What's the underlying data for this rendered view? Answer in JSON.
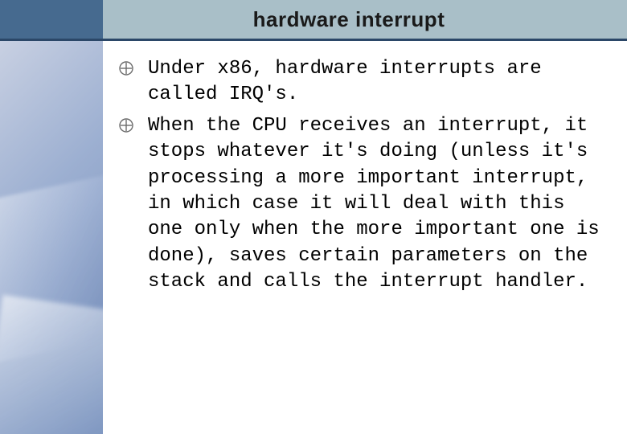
{
  "title": "hardware interrupt",
  "bullets": [
    {
      "text": "Under x86, hardware interrupts are called IRQ's."
    },
    {
      "text": "When the CPU receives an interrupt, it stops whatever it's doing (unless it's processing a more important interrupt, in which case it will deal with this one only when the more important one is done), saves certain parameters on the stack and calls the interrupt handler."
    }
  ],
  "colors": {
    "header_bg": "#a9bfc8",
    "corner": "#466a8f",
    "divider": "#2b4768"
  }
}
